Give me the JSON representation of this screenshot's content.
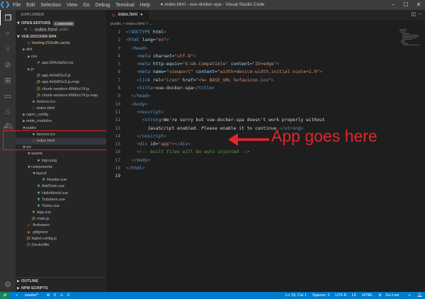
{
  "menu": [
    "File",
    "Edit",
    "Selection",
    "View",
    "Go",
    "Debug",
    "Terminal",
    "Help"
  ],
  "window_title": "● index.html - vue-docker-spa - Visual Studio Code",
  "sidebar": {
    "title": "EXPLORER",
    "open_editors": {
      "label": "OPEN EDITORS",
      "badge": "1 UNSAVED",
      "file": "index.html",
      "folder": "public"
    },
    "project": "VUE-DOCKER-SPA",
    "tree": [
      {
        "label": "hosting.ZGlzdA.cache",
        "depth": 1,
        "type": "file",
        "color": "#e2c08d"
      },
      {
        "label": "dist",
        "depth": 1,
        "type": "folder"
      },
      {
        "label": "css",
        "depth": 2,
        "type": "folder"
      },
      {
        "label": "app.694cda5d.css",
        "depth": 3,
        "type": "file"
      },
      {
        "label": "js",
        "depth": 2,
        "type": "folder"
      },
      {
        "label": "app.4e5d01e3.js",
        "depth": 3,
        "type": "file"
      },
      {
        "label": "app.4e5d01e3.js.map",
        "depth": 3,
        "type": "file"
      },
      {
        "label": "chunk-vendors.49b6cc74.js",
        "depth": 3,
        "type": "file"
      },
      {
        "label": "chunk-vendors.49b6cc74.js.map",
        "depth": 3,
        "type": "file"
      },
      {
        "label": "favicon.ico",
        "depth": 2,
        "type": "file"
      },
      {
        "label": "index.html",
        "depth": 2,
        "type": "file"
      },
      {
        "label": "nginx_config",
        "depth": 1,
        "type": "folder"
      },
      {
        "label": "node_modules",
        "depth": 1,
        "type": "folder"
      },
      {
        "label": "public",
        "depth": 1,
        "type": "folder",
        "open": true
      },
      {
        "label": "favicon.ico",
        "depth": 2,
        "type": "file"
      },
      {
        "label": "index.html",
        "depth": 2,
        "type": "file",
        "selected": true
      },
      {
        "label": "src",
        "depth": 1,
        "type": "folder",
        "open": true
      },
      {
        "label": "assets",
        "depth": 2,
        "type": "folder",
        "open": true
      },
      {
        "label": "logo.png",
        "depth": 3,
        "type": "file"
      },
      {
        "label": "components",
        "depth": 2,
        "type": "folder",
        "open": true
      },
      {
        "label": "layout",
        "depth": 3,
        "type": "folder",
        "open": true
      },
      {
        "label": "Header.vue",
        "depth": 4,
        "type": "file"
      },
      {
        "label": "AddTodo.vue",
        "depth": 3,
        "type": "file"
      },
      {
        "label": "HelloWorld.vue",
        "depth": 3,
        "type": "file"
      },
      {
        "label": "TodoItem.vue",
        "depth": 3,
        "type": "file"
      },
      {
        "label": "Todos.vue",
        "depth": 3,
        "type": "file"
      },
      {
        "label": "App.vue",
        "depth": 2,
        "type": "file"
      },
      {
        "label": "main.js",
        "depth": 2,
        "type": "file"
      },
      {
        "label": ".firebaserc",
        "depth": 1,
        "type": "file"
      },
      {
        "label": ".gitignore",
        "depth": 1,
        "type": "file"
      },
      {
        "label": "babel.config.js",
        "depth": 1,
        "type": "file"
      },
      {
        "label": "Dockerfile",
        "depth": 1,
        "type": "file"
      }
    ],
    "outline": "OUTLINE",
    "npm": "NPM SCRIPTS"
  },
  "editor": {
    "tab": "index.html",
    "breadcrumb": "public  >  index.html  >  ...",
    "current_line": 19,
    "lines": [
      [
        [
          "punc",
          "<"
        ],
        [
          "tag",
          "!DOCTYPE "
        ],
        [
          "attr",
          "html"
        ],
        [
          "punc",
          ">"
        ]
      ],
      [
        [
          "punc",
          "<"
        ],
        [
          "tag",
          "html "
        ],
        [
          "attr",
          "lang"
        ],
        [
          "txt",
          "="
        ],
        [
          "str",
          "\"en\""
        ],
        [
          "punc",
          ">"
        ]
      ],
      [
        [
          "txt",
          "  "
        ],
        [
          "punc",
          "<"
        ],
        [
          "tag",
          "head"
        ],
        [
          "punc",
          ">"
        ]
      ],
      [
        [
          "txt",
          "    "
        ],
        [
          "punc",
          "<"
        ],
        [
          "tag",
          "meta "
        ],
        [
          "attr",
          "charset"
        ],
        [
          "txt",
          "="
        ],
        [
          "str",
          "\"utf-8\""
        ],
        [
          "punc",
          ">"
        ]
      ],
      [
        [
          "txt",
          "    "
        ],
        [
          "punc",
          "<"
        ],
        [
          "tag",
          "meta "
        ],
        [
          "attr",
          "http-equiv"
        ],
        [
          "txt",
          "="
        ],
        [
          "str",
          "\"X-UA-Compatible\" "
        ],
        [
          "attr",
          "content"
        ],
        [
          "txt",
          "="
        ],
        [
          "str",
          "\"IE=edge\""
        ],
        [
          "punc",
          ">"
        ]
      ],
      [
        [
          "txt",
          "    "
        ],
        [
          "punc",
          "<"
        ],
        [
          "tag",
          "meta "
        ],
        [
          "attr",
          "name"
        ],
        [
          "txt",
          "="
        ],
        [
          "str",
          "\"viewport\" "
        ],
        [
          "attr",
          "content"
        ],
        [
          "txt",
          "="
        ],
        [
          "str",
          "\"width=device-width,initial-scale=1.0\""
        ],
        [
          "punc",
          ">"
        ]
      ],
      [
        [
          "txt",
          "    "
        ],
        [
          "punc",
          "<"
        ],
        [
          "tag",
          "link "
        ],
        [
          "attr",
          "rel"
        ],
        [
          "txt",
          "="
        ],
        [
          "str",
          "\"icon\" "
        ],
        [
          "attr",
          "href"
        ],
        [
          "txt",
          "="
        ],
        [
          "str",
          "\"<%= BASE_URL %>favicon.ico\""
        ],
        [
          "punc",
          ">"
        ]
      ],
      [
        [
          "txt",
          "    "
        ],
        [
          "punc",
          "<"
        ],
        [
          "tag",
          "title"
        ],
        [
          "punc",
          ">"
        ],
        [
          "txt",
          "vue-docker-spa"
        ],
        [
          "punc",
          "</"
        ],
        [
          "tag",
          "title"
        ],
        [
          "punc",
          ">"
        ]
      ],
      [
        [
          "txt",
          "  "
        ],
        [
          "punc",
          "</"
        ],
        [
          "tag",
          "head"
        ],
        [
          "punc",
          ">"
        ]
      ],
      [
        [
          "txt",
          "  "
        ],
        [
          "punc",
          "<"
        ],
        [
          "tag",
          "body"
        ],
        [
          "punc",
          ">"
        ]
      ],
      [
        [
          "txt",
          "    "
        ],
        [
          "punc",
          "<"
        ],
        [
          "tag",
          "noscript"
        ],
        [
          "punc",
          ">"
        ]
      ],
      [
        [
          "txt",
          "      "
        ],
        [
          "punc",
          "<"
        ],
        [
          "tag",
          "strong"
        ],
        [
          "punc",
          ">"
        ],
        [
          "txt",
          "We're sorry but vue-docker-spa doesn't work properly without"
        ]
      ],
      [
        [
          "txt",
          "        JavaScript enabled. Please enable it to continue."
        ],
        [
          "punc",
          "</"
        ],
        [
          "tag",
          "strong"
        ],
        [
          "punc",
          ">"
        ]
      ],
      [
        [
          "txt",
          "    "
        ],
        [
          "punc",
          "</"
        ],
        [
          "tag",
          "noscript"
        ],
        [
          "punc",
          ">"
        ]
      ],
      [
        [
          "txt",
          "    "
        ],
        [
          "punc",
          "<"
        ],
        [
          "tag",
          "div "
        ],
        [
          "attr",
          "id"
        ],
        [
          "txt",
          "="
        ],
        [
          "str",
          "\"app\""
        ],
        [
          "punc",
          "></"
        ],
        [
          "tag",
          "div"
        ],
        [
          "punc",
          ">"
        ]
      ],
      [
        [
          "txt",
          "    "
        ],
        [
          "cmt",
          "<!-- built files will be auto injected -->"
        ]
      ],
      [
        [
          "txt",
          "  "
        ],
        [
          "punc",
          "</"
        ],
        [
          "tag",
          "body"
        ],
        [
          "punc",
          ">"
        ]
      ],
      [
        [
          "punc",
          "</"
        ],
        [
          "tag",
          "html"
        ],
        [
          "punc",
          ">"
        ]
      ],
      []
    ]
  },
  "annotation": "App goes here",
  "status": {
    "branch": "master*",
    "errors": "0",
    "warnings": "0",
    "position": "Ln 19, Col 1",
    "spaces": "Spaces: 2",
    "encoding": "UTF-8",
    "eol": "LF",
    "language": "HTML",
    "golive": "Go Live"
  },
  "colors": {
    "annotation": "#e3242b",
    "statusbar": "#007acc"
  }
}
